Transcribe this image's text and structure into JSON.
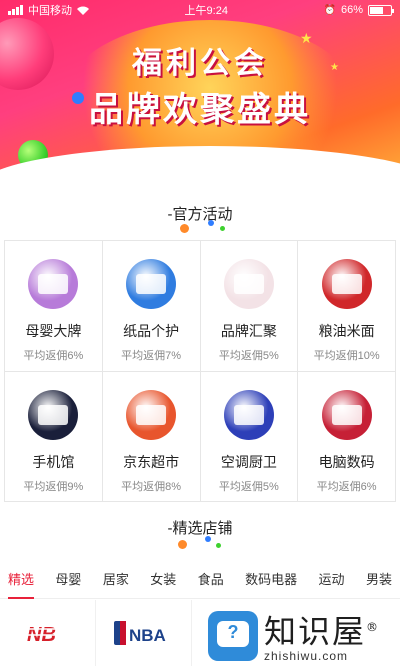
{
  "status_bar": {
    "carrier": "中国移动",
    "time": "上午9:24",
    "battery": "66%",
    "battery_level": 0.66
  },
  "banner": {
    "line1": "福利公会",
    "line2": "品牌欢聚盛典"
  },
  "official": {
    "heading": "-官方活动"
  },
  "activities": [
    {
      "title": "母婴大牌",
      "sub": "平均返佣6%",
      "color": "#b77bd9"
    },
    {
      "title": "纸品个护",
      "sub": "平均返佣7%",
      "color": "#2f7ce0"
    },
    {
      "title": "品牌汇聚",
      "sub": "平均返佣5%",
      "color": "#f3e2e6"
    },
    {
      "title": "粮油米面",
      "sub": "平均返佣10%",
      "color": "#d0272a"
    },
    {
      "title": "手机馆",
      "sub": "平均返佣9%",
      "color": "#1a1f3a"
    },
    {
      "title": "京东超市",
      "sub": "平均返佣8%",
      "color": "#e8552d"
    },
    {
      "title": "空调厨卫",
      "sub": "平均返佣5%",
      "color": "#2d3fb8"
    },
    {
      "title": "电脑数码",
      "sub": "平均返佣6%",
      "color": "#c62036"
    }
  ],
  "shops": {
    "heading": "-精选店铺"
  },
  "tabs": [
    "精选",
    "母婴",
    "居家",
    "女装",
    "食品",
    "数码电器",
    "运动",
    "男装"
  ],
  "stores": [
    "NB",
    "NBA"
  ],
  "watermark": {
    "cn": "知识屋",
    "reg": "®",
    "en": "zhishiwu.com"
  }
}
